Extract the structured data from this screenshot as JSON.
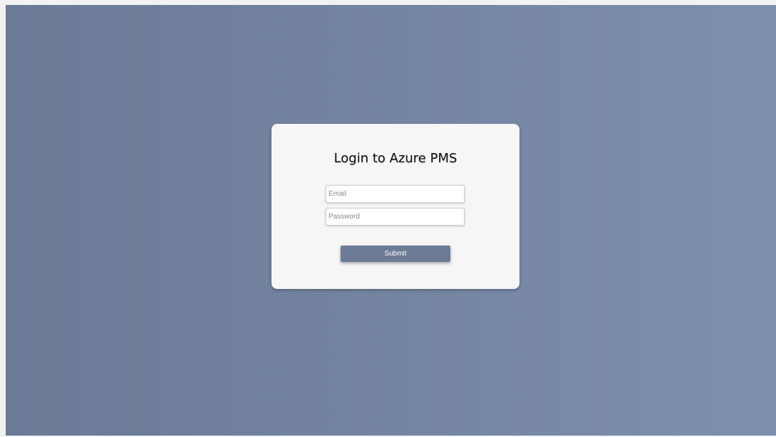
{
  "login": {
    "title": "Login to Azure PMS",
    "email_placeholder": "Email",
    "email_value": "",
    "password_placeholder": "Password",
    "password_value": "",
    "submit_label": "Submit"
  },
  "colors": {
    "background_gradient_start": "#6b7a95",
    "background_gradient_end": "#7e8fae",
    "card_background": "#f6f6f6",
    "button_background": "#6c7b95",
    "button_text": "#ffffff"
  }
}
